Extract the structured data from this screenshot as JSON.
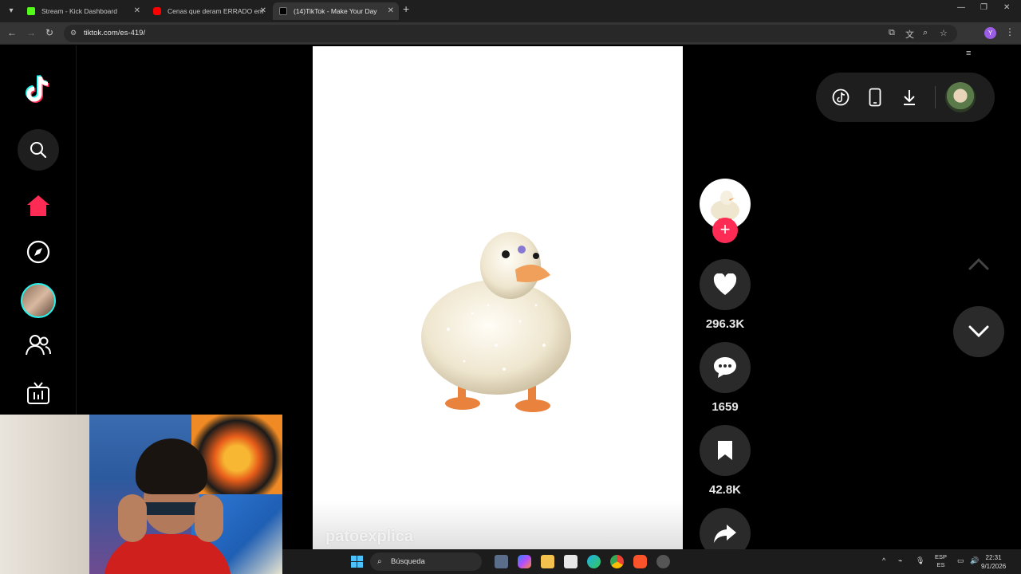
{
  "browser": {
    "tabs": [
      {
        "title": "Stream - Kick Dashboard",
        "color": "#53fc18"
      },
      {
        "title": "Cenas que deram ERRADO em",
        "color": "#ff0000"
      },
      {
        "title": "(14)TikTok - Make Your Day",
        "color": "#ffffff"
      }
    ],
    "url": "tiktok.com/es-419/"
  },
  "video": {
    "watermark": "patoexplica"
  },
  "actions": {
    "likes": "296.3K",
    "comments": "1659",
    "saves": "42.8K"
  },
  "taskbar": {
    "search_label": "Búsqueda",
    "lang_top": "ESP",
    "lang_bottom": "ES",
    "time": "22:31",
    "date": "9/1/2026"
  },
  "colors": {
    "accent": "#fe2c55",
    "cyan": "#25f4ee"
  }
}
